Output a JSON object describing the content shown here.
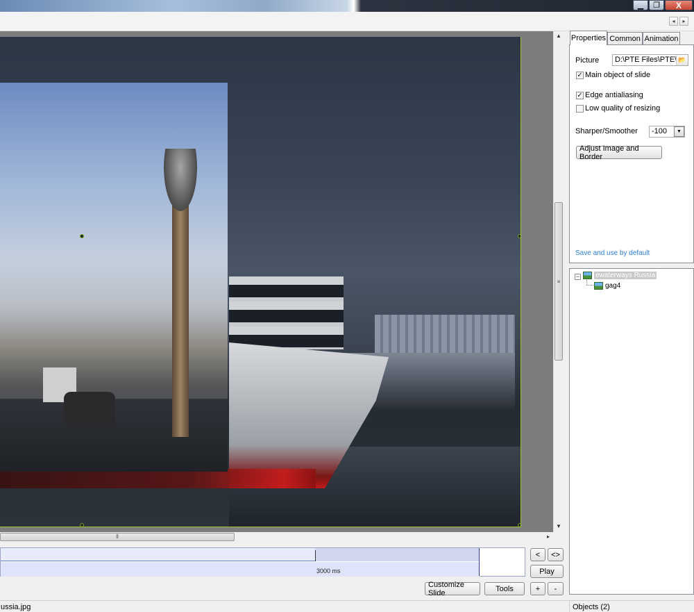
{
  "properties_panel": {
    "tabs": [
      "Properties",
      "Common",
      "Animation"
    ],
    "active_tab": "Properties",
    "picture_label": "Picture",
    "picture_value": "D:\\PTE Files\\PTE\\wc",
    "main_object_label": "Main object of slide",
    "main_object_checked": true,
    "edge_antialiasing_label": "Edge antialiasing",
    "edge_antialiasing_checked": true,
    "low_quality_label": "Low quality of resizing",
    "low_quality_checked": false,
    "sharper_label": "Sharper/Smoother",
    "sharper_value": "-100",
    "adjust_button": "Adjust Image and Border",
    "save_default_link": "Save and use by default"
  },
  "objects_tree": {
    "root": "ewaterways Russia",
    "children": [
      "gag4"
    ]
  },
  "timeline": {
    "duration_label": "3000 ms"
  },
  "timeline_buttons": {
    "prev": "<",
    "expand": "<>",
    "play": "Play"
  },
  "bottom_buttons": {
    "customize": "Customize Slide",
    "tools": "Tools",
    "plus": "+",
    "minus": "-"
  },
  "status": {
    "file": "ussia.jpg",
    "objects": "Objects (2)"
  },
  "window_controls": {
    "minimize": "▁",
    "maximize": "❐",
    "close": "X"
  },
  "nav": {
    "left": "◂",
    "right": "▸"
  },
  "scroll": {
    "grip_v": "≡",
    "grip_h": "⦀",
    "up": "▲",
    "down": "▼",
    "right": "▸"
  },
  "checkmark": "✓",
  "tree_toggle": "−"
}
